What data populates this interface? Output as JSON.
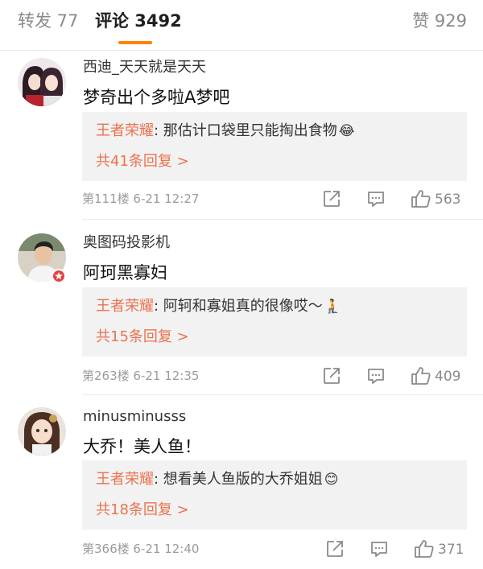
{
  "tabs": {
    "repost": "转发 77",
    "comments": "评论 3492",
    "likes": "赞 929"
  },
  "accent_color": "#ff8200",
  "link_color": "#eb7350",
  "comments": [
    {
      "username": "西迪_天天就是天天",
      "content": "梦奇出个多啦A梦吧",
      "reply": {
        "author": "王者荣耀",
        "text": ": 那估计口袋里只能掏出食物",
        "emoji": "😂",
        "more": "共41条回复 >"
      },
      "meta": "第111楼  6-21 12:27",
      "likes": "563",
      "avatar_icon": "anime-girls-avatar"
    },
    {
      "username": "奥图码投影机",
      "content": "阿珂黑寡妇",
      "reply": {
        "author": "王者荣耀",
        "text": ": 阿轲和寡姐真的很像哎～",
        "emoji": "🧎",
        "more": "共15条回复 >"
      },
      "meta": "第263楼  6-21 12:35",
      "likes": "409",
      "avatar_icon": "person-photo-avatar",
      "verified_badge": "verified-badge"
    },
    {
      "username": "minusminusss",
      "content": "大乔！美人鱼！",
      "reply": {
        "author": "王者荣耀",
        "text": ": 想看美人鱼版的大乔姐姐",
        "emoji": "😊",
        "more": "共18条回复 >"
      },
      "meta": "第366楼  6-21 12:40",
      "likes": "371",
      "avatar_icon": "anime-character-avatar"
    }
  ]
}
